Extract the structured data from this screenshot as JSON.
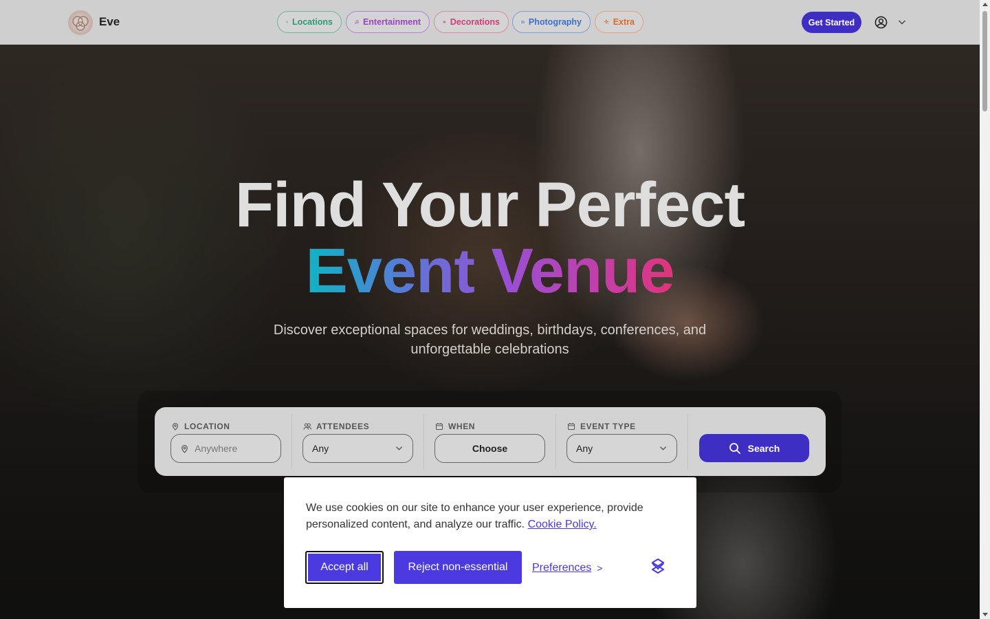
{
  "header": {
    "brand": "Eve",
    "nav": [
      {
        "label": "Locations",
        "icon": "building-icon",
        "color": "#2a9d74"
      },
      {
        "label": "Entertainment",
        "icon": "music-icon",
        "color": "#9b42c9"
      },
      {
        "label": "Decorations",
        "icon": "flower-icon",
        "color": "#d23d76"
      },
      {
        "label": "Photography",
        "icon": "camera-icon",
        "color": "#3b6fd6"
      },
      {
        "label": "Extra",
        "icon": "sparkle-icon",
        "color": "#dd6a2a"
      }
    ],
    "cta_label": "Get Started",
    "cta_color": "#3f2ec4"
  },
  "hero": {
    "title_line1": "Find Your Perfect",
    "title_line2": "Event Venue",
    "subtitle": "Discover exceptional spaces for weddings, birthdays, conferences, and unforgettable celebrations"
  },
  "search": {
    "fields": [
      {
        "label": "LOCATION",
        "icon": "pin-icon",
        "placeholder": "Anywhere"
      },
      {
        "label": "ATTENDEES",
        "icon": "users-icon",
        "value": "Any"
      },
      {
        "label": "WHEN",
        "icon": "calendar-icon",
        "value": "Choose"
      },
      {
        "label": "EVENT TYPE",
        "icon": "calendar-icon",
        "value": "Any"
      }
    ],
    "button_label": "Search"
  },
  "cookie": {
    "text": "We use cookies on our site to enhance your user experience, provide personalized content, and analyze our traffic.",
    "policy_link": "Cookie Policy.",
    "accept_label": "Accept all",
    "reject_label": "Reject non-essential",
    "preferences_label": "Preferences",
    "preferences_arrow": ">",
    "accent_color": "#4b3adf"
  }
}
